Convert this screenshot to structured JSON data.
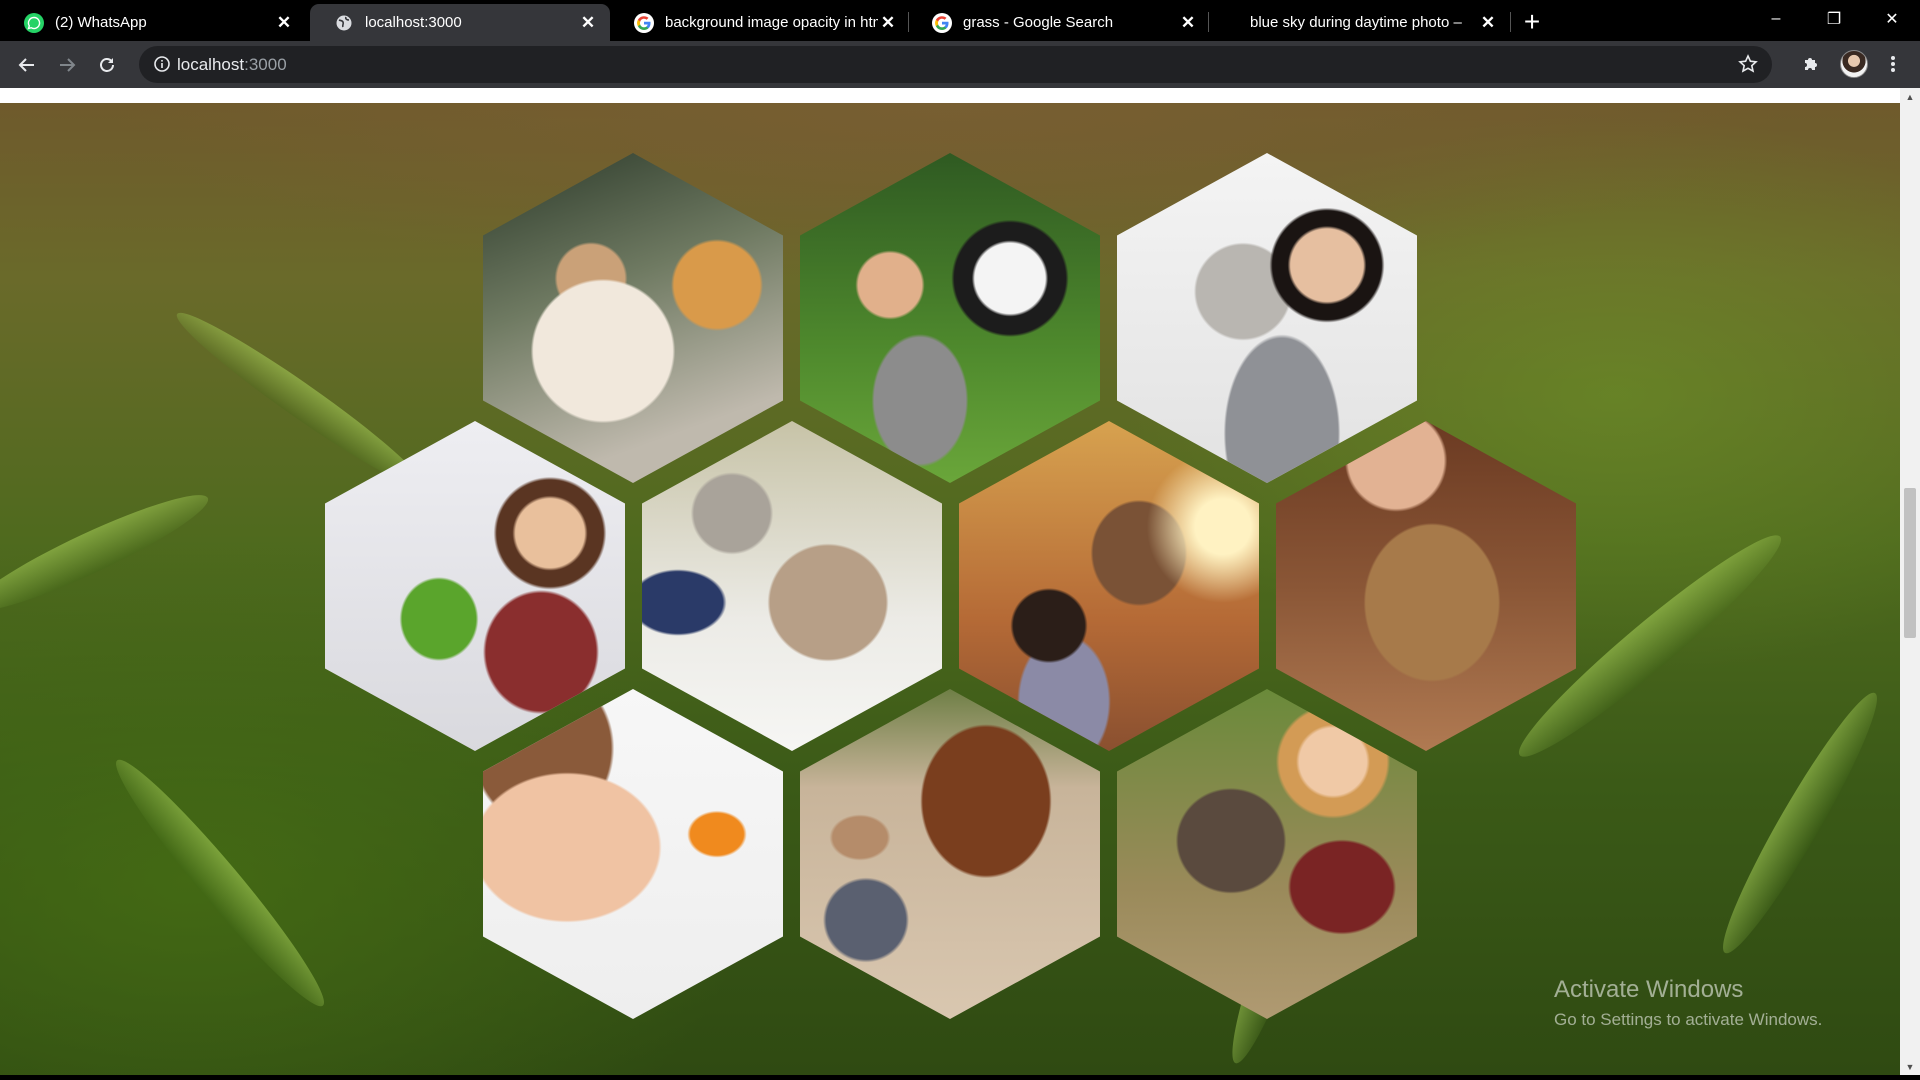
{
  "browser": {
    "tabs": [
      {
        "title": "(2) WhatsApp",
        "icon": "whatsapp-icon",
        "active": false
      },
      {
        "title": "localhost:3000",
        "icon": "globe-icon",
        "active": true
      },
      {
        "title": "background image opacity in htm",
        "icon": "google-icon",
        "active": false
      },
      {
        "title": "grass - Google Search",
        "icon": "google-icon",
        "active": false
      },
      {
        "title": "blue sky during daytime photo –",
        "icon": "",
        "active": false
      }
    ],
    "new_tab_label": "+",
    "address": {
      "host": "localhost",
      "port": ":3000"
    },
    "window_controls": {
      "minimize": "–",
      "restore": "❐",
      "close": "✕"
    }
  },
  "gallery": {
    "hexagons": [
      {
        "subject": "woman hugging golden retriever"
      },
      {
        "subject": "boy with black and white dog"
      },
      {
        "subject": "woman hugging grey cat"
      },
      {
        "subject": "girl with green parrot"
      },
      {
        "subject": "elderly woman with cat"
      },
      {
        "subject": "woman with horse at sunset"
      },
      {
        "subject": "woman cuddling rabbit"
      },
      {
        "subject": "child with goldfish bowl"
      },
      {
        "subject": "girl with brown horse"
      },
      {
        "subject": "woman hugging dog"
      }
    ]
  },
  "watermark": {
    "title": "Activate Windows",
    "subtitle": "Go to Settings to activate Windows."
  },
  "colors": {
    "tab_bar": "#000000",
    "toolbar": "#35363a",
    "omnibox": "#202124",
    "grass_dark": "#2f4a12",
    "grass_light": "#6f5a2c"
  }
}
